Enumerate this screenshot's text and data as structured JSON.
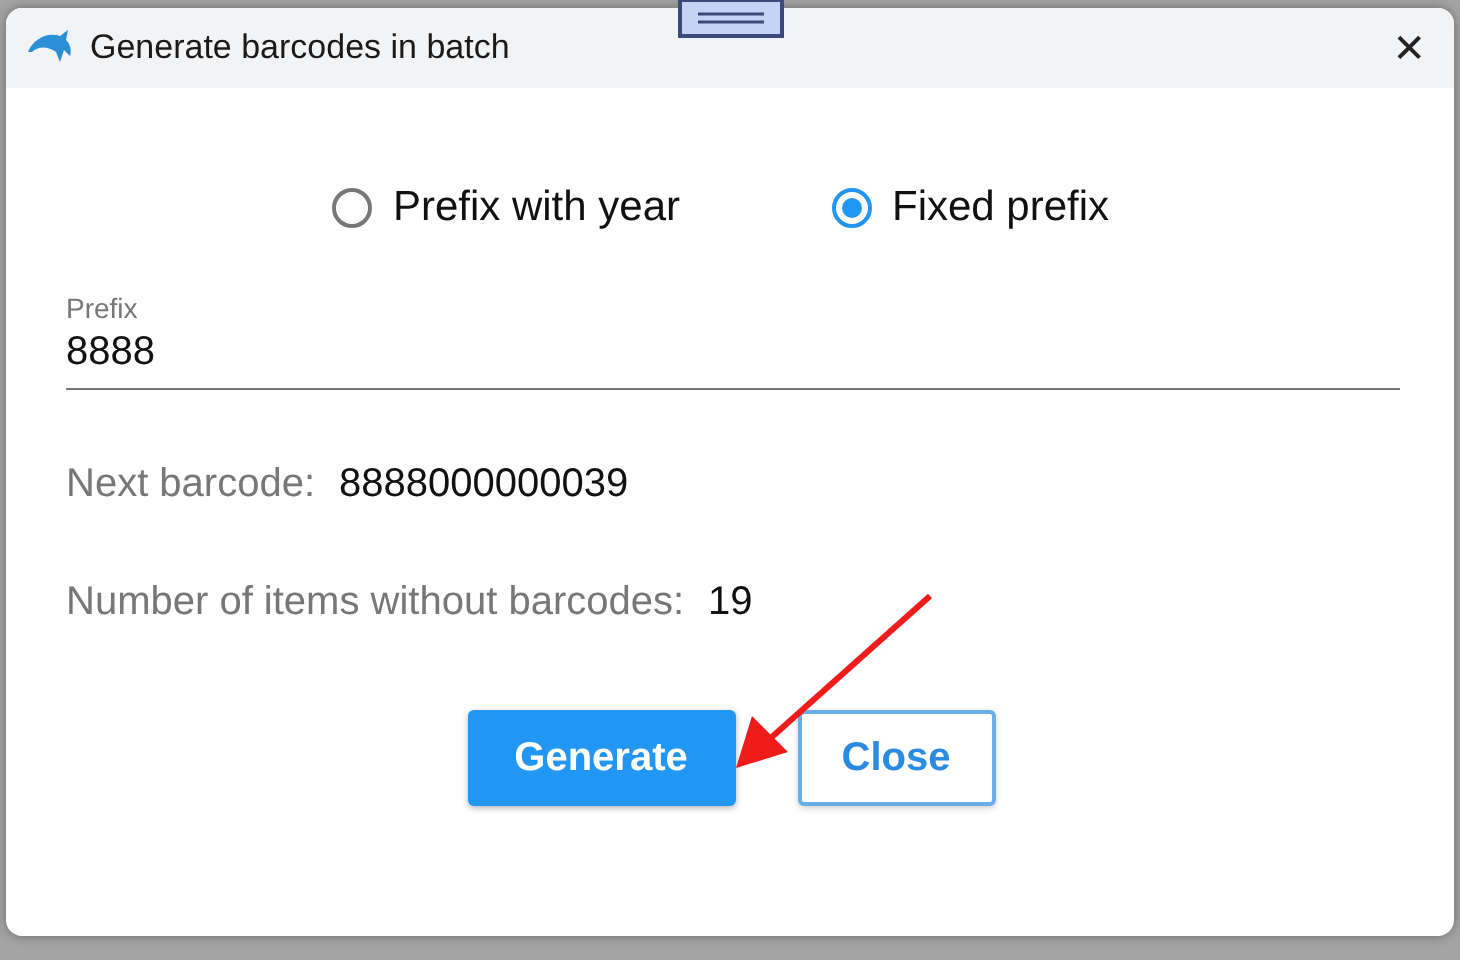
{
  "window": {
    "title": "Generate barcodes in batch",
    "close": "✕"
  },
  "prefix_mode": [
    {
      "label": "Prefix with year",
      "selected": false
    },
    {
      "label": "Fixed prefix",
      "selected": true
    }
  ],
  "prefix_field": {
    "label": "Prefix",
    "value": "8888"
  },
  "info": [
    {
      "label": "Next barcode:",
      "value": "8888000000039"
    },
    {
      "label": "Number of items without barcodes:",
      "value": "19"
    }
  ],
  "buttons": [
    {
      "label": "Generate",
      "kind": "primary"
    },
    {
      "label": "Close",
      "kind": "secondary"
    }
  ]
}
